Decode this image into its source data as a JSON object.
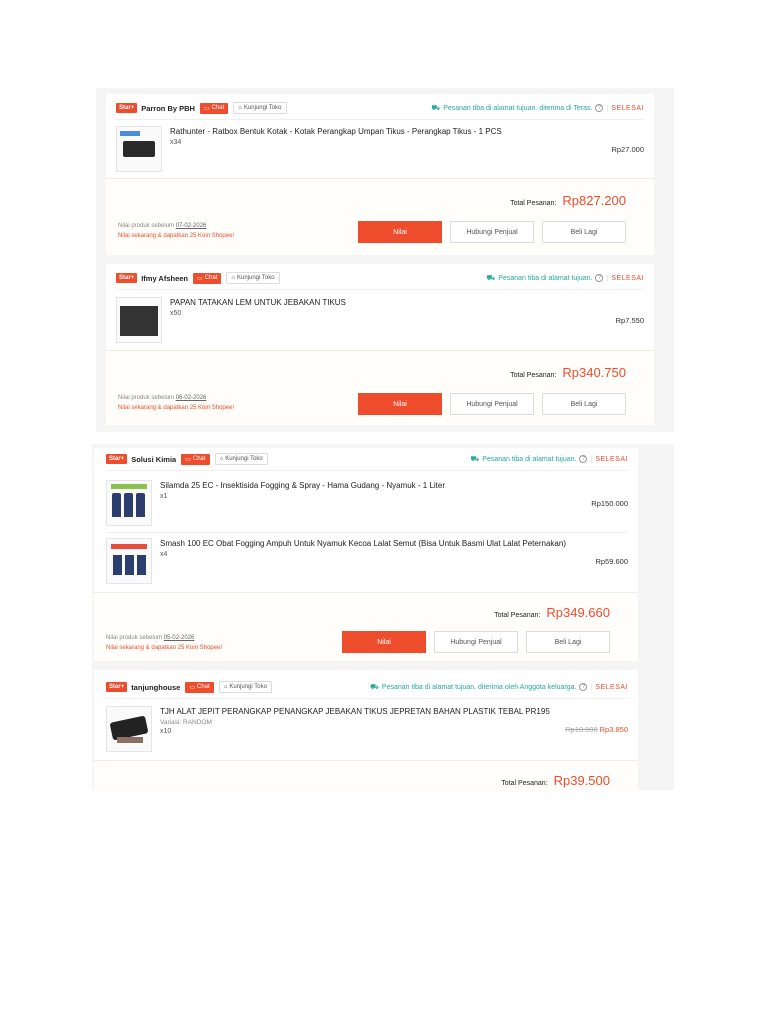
{
  "labels": {
    "mall_badge": "Star+",
    "chat": "Chat",
    "visit_store": "Kunjungi Toko",
    "done": "SELESAI",
    "total_label": "Total Pesanan:",
    "rate": "Nilai",
    "contact_seller": "Hubungi Penjual",
    "buy_again": "Beli Lagi",
    "help_symbol": "?",
    "separator": "|"
  },
  "orders": [
    {
      "shop": "Parron By PBH",
      "status": "Pesanan tiba di alamat tujuan. diterima di Teras.",
      "items": [
        {
          "name": "Rathunter - Ratbox Bentuk Kotak - Kotak Perangkap Umpan Tikus - Perangkap Tikus - 1 PCS",
          "qty": "x34",
          "price": "Rp27.000"
        }
      ],
      "total": "Rp827.200",
      "note_prefix": "Nilai produk sebelum",
      "note_date": "07-02-2026",
      "note_promo": "Nilai sekarang & dapatkan 25 Koin Shopee!"
    },
    {
      "shop": "Ifmy Afsheen",
      "status": "Pesanan tiba di alamat tujuan.",
      "items": [
        {
          "name": "PAPAN TATAKAN LEM UNTUK JEBAKAN TIKUS",
          "qty": "x50",
          "price": "Rp7.550"
        }
      ],
      "total": "Rp340.750",
      "note_prefix": "Nilai produk sebelum",
      "note_date": "06-02-2026",
      "note_promo": "Nilai sekarang & dapatkan 25 Koin Shopee!"
    },
    {
      "shop": "Solusi Kimia",
      "status": "Pesanan tiba di alamat tujuan.",
      "items": [
        {
          "name": "Silamda 25 EC - Insektisida Fogging & Spray - Hama Gudang - Nyamuk - 1 Liter",
          "qty": "x1",
          "price": "Rp150.000"
        },
        {
          "name": "Smash 100 EC Obat Fogging Ampuh Untuk Nyamuk Kecoa Lalat Semut (Bisa Untuk Basmi Ulat Lalat Peternakan)",
          "qty": "x4",
          "price": "Rp59.600"
        }
      ],
      "total": "Rp349.660",
      "note_prefix": "Nilai produk sebelum",
      "note_date": "05-02-2026",
      "note_promo": "Nilai sekarang & dapatkan 25 Koin Shopee!"
    },
    {
      "shop": "tanjunghouse",
      "status": "Pesanan tiba di alamat tujuan. diterima oleh Anggota keluarga.",
      "items": [
        {
          "name": "TJH ALAT JEPIT PERANGKAP PENANGKAP JEBAKAN TIKUS JEPRETAN BAHAN PLASTIK TEBAL PR195",
          "variant": "Variasi: RANDOM",
          "qty": "x10",
          "price_original": "Rp10.000",
          "price": "Rp3.850"
        }
      ],
      "total": "Rp39.500"
    }
  ],
  "colors": {
    "accent": "#ee4d2d",
    "status_green": "#26aa99"
  }
}
